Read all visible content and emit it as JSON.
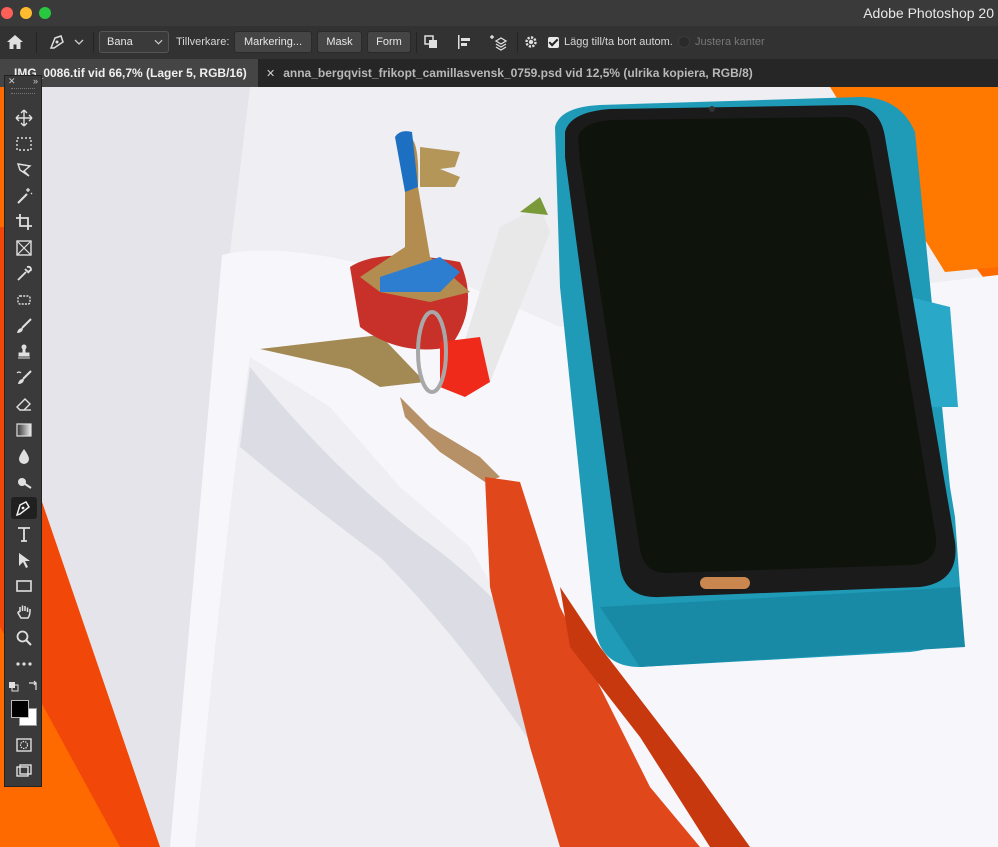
{
  "window": {
    "title": "Adobe Photoshop 20"
  },
  "options_bar": {
    "mode_select": "Bana",
    "make_label": "Tillverkare:",
    "selection_button": "Markering...",
    "mask_button": "Mask",
    "shape_button": "Form",
    "auto_add_delete_label": "Lägg till/ta bort autom.",
    "auto_add_delete_checked": true,
    "align_edges_label": "Justera kanter",
    "align_edges_enabled": false
  },
  "tabs": [
    {
      "label": "IMG_0086.tif vid 66,7% (Lager 5, RGB/16)",
      "active": true
    },
    {
      "label": "anna_bergqvist_frikopt_camillasvensk_0759.psd vid 12,5% (ulrika kopiera, RGB/8)",
      "active": false
    }
  ],
  "toolbar": {
    "tools": [
      "move-tool",
      "marquee-tool",
      "lasso-tool",
      "magic-wand-tool",
      "crop-tool",
      "frame-tool",
      "eyedropper-tool",
      "patch-tool",
      "brush-tool",
      "stamp-tool",
      "history-brush-tool",
      "eraser-tool",
      "gradient-tool",
      "blur-tool",
      "dodge-tool",
      "pen-tool",
      "type-tool",
      "path-selection-tool",
      "rectangle-tool",
      "hand-tool",
      "zoom-tool",
      "more-tools"
    ],
    "active_tool": "pen-tool",
    "foreground_color": "#000000",
    "background_color": "#ffffff"
  },
  "colors": {
    "ui_bg": "#323232",
    "accent_orange": "#ff6a00",
    "phone_case": "#1f9bb8"
  }
}
